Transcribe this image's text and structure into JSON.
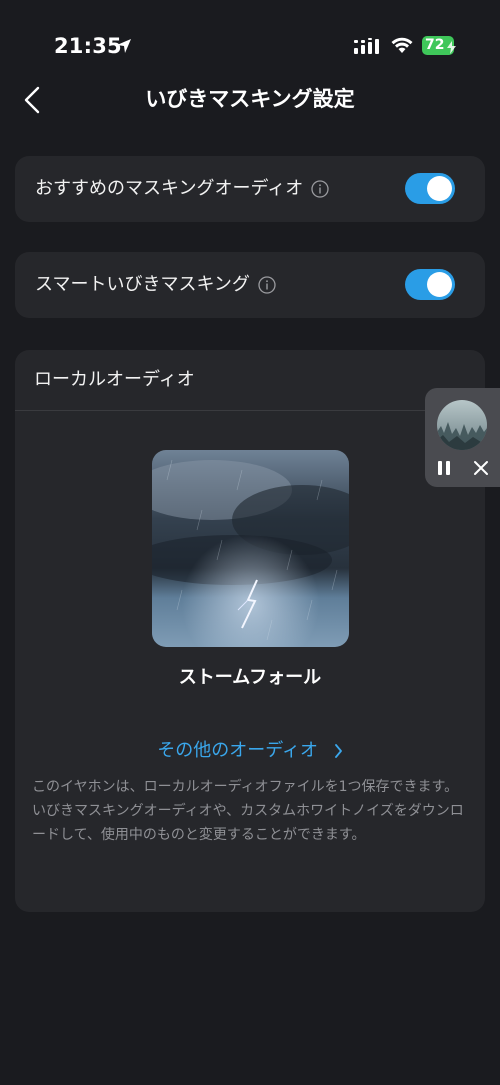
{
  "status_bar": {
    "time": "21:35",
    "battery_level": "72",
    "location_icon": "location-arrow-icon",
    "signal_icon": "cellular-signal-icon",
    "wifi_icon": "wifi-icon",
    "battery_icon": "battery-charging-icon"
  },
  "header": {
    "title": "いびきマスキング設定",
    "back_icon": "chevron-left-icon"
  },
  "settings": [
    {
      "label": "おすすめのマスキングオーディオ",
      "enabled": true
    },
    {
      "label": "スマートいびきマスキング",
      "enabled": true
    }
  ],
  "local_audio": {
    "title": "ローカルオーディオ",
    "track_name": "ストームフォール",
    "more_link": "その他のオーディオ",
    "description": "このイヤホンは、ローカルオーディオファイルを1つ保存できます。いびきマスキングオーディオや、カスタムホワイトノイズをダウンロードして、使用中のものと変更することができます。"
  },
  "mini_player": {
    "pause_icon": "pause-icon",
    "close_icon": "close-icon"
  },
  "colors": {
    "background": "#1a1b1f",
    "card": "#26272b",
    "accent": "#2a9de6",
    "link": "#3aa7ec",
    "muted_text": "#8f9095",
    "battery": "#3fc75a"
  }
}
